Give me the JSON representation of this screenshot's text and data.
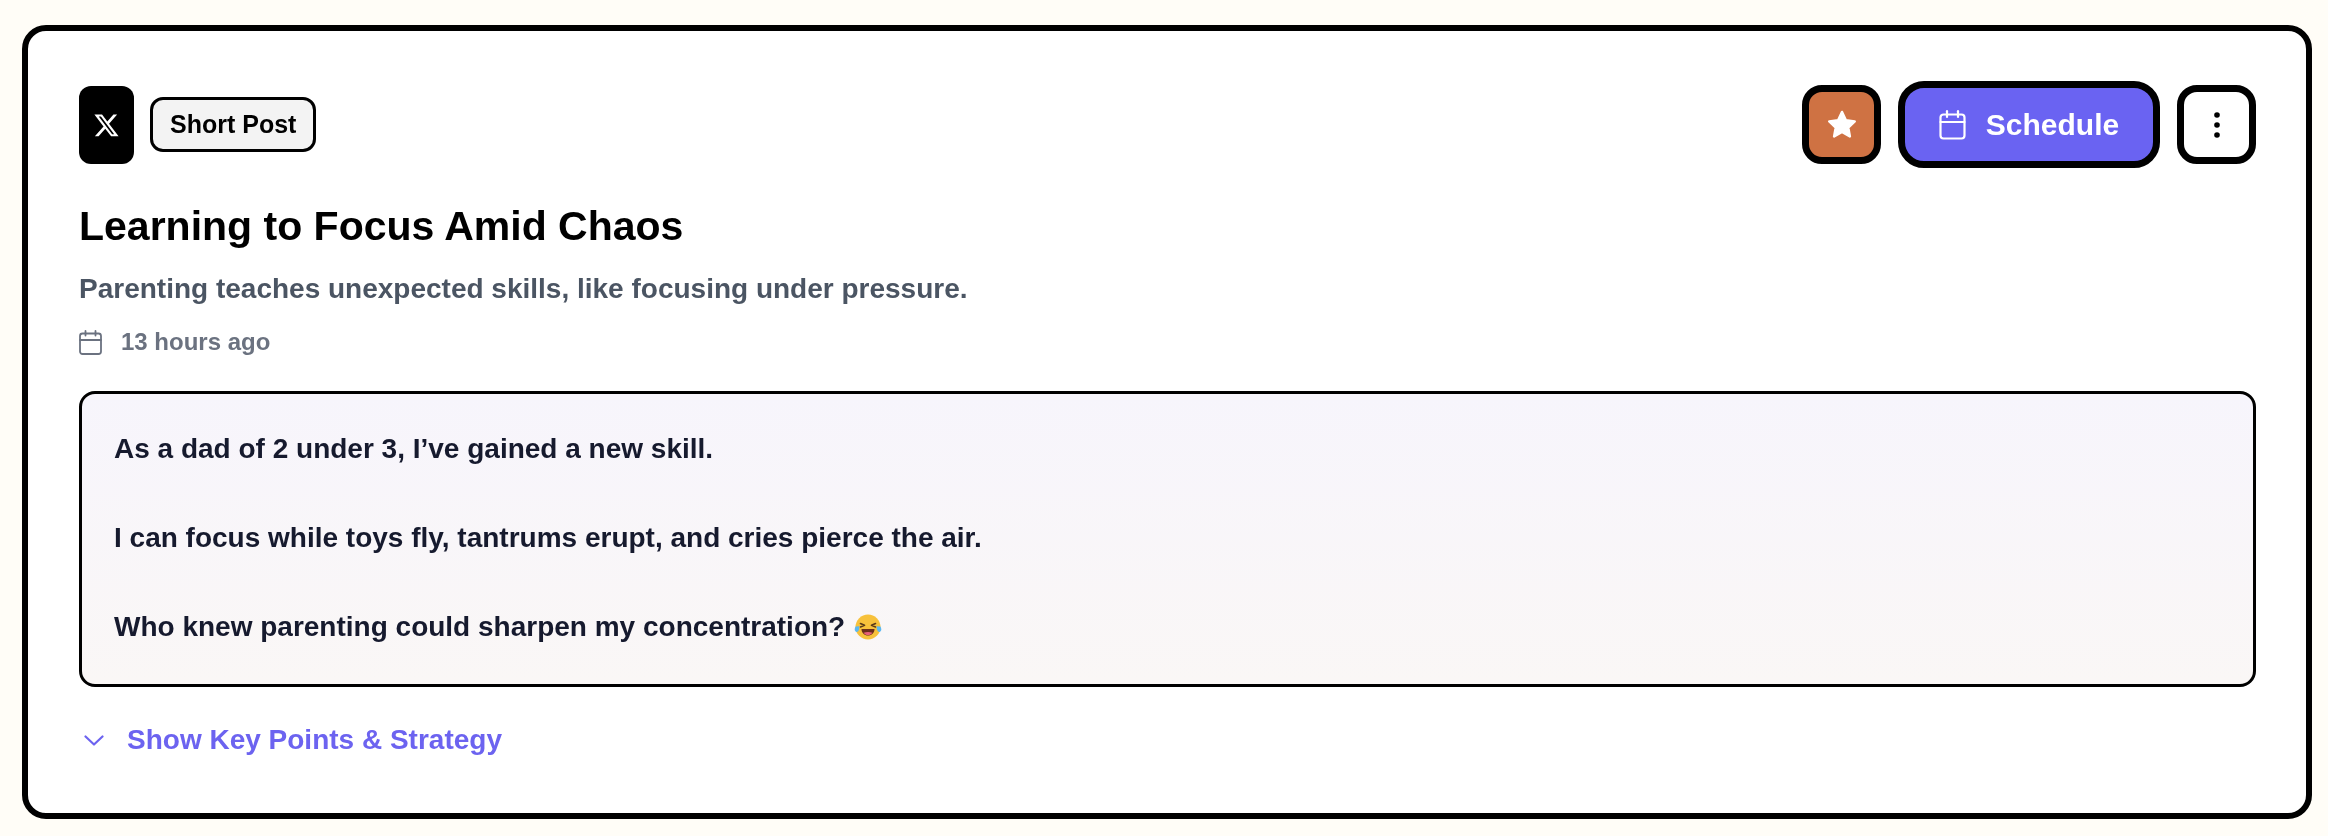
{
  "post": {
    "type_badge": "Short Post",
    "starred": true,
    "schedule_button": "Schedule",
    "title": "Learning to Focus Amid Chaos",
    "summary": "Parenting teaches unexpected skills, like focusing under pressure.",
    "timestamp": "13 hours ago",
    "body": [
      {
        "text": "As a dad of 2 under 3, I’ve gained a new skill.",
        "emoji": false
      },
      {
        "text": "I can focus while toys fly, tantrums erupt, and cries pierce the air.",
        "emoji": false
      },
      {
        "text": "Who knew parenting could sharpen my concentration?",
        "emoji": true
      }
    ],
    "toggle": {
      "label": "Show Key Points & Strategy",
      "expanded": false
    }
  }
}
